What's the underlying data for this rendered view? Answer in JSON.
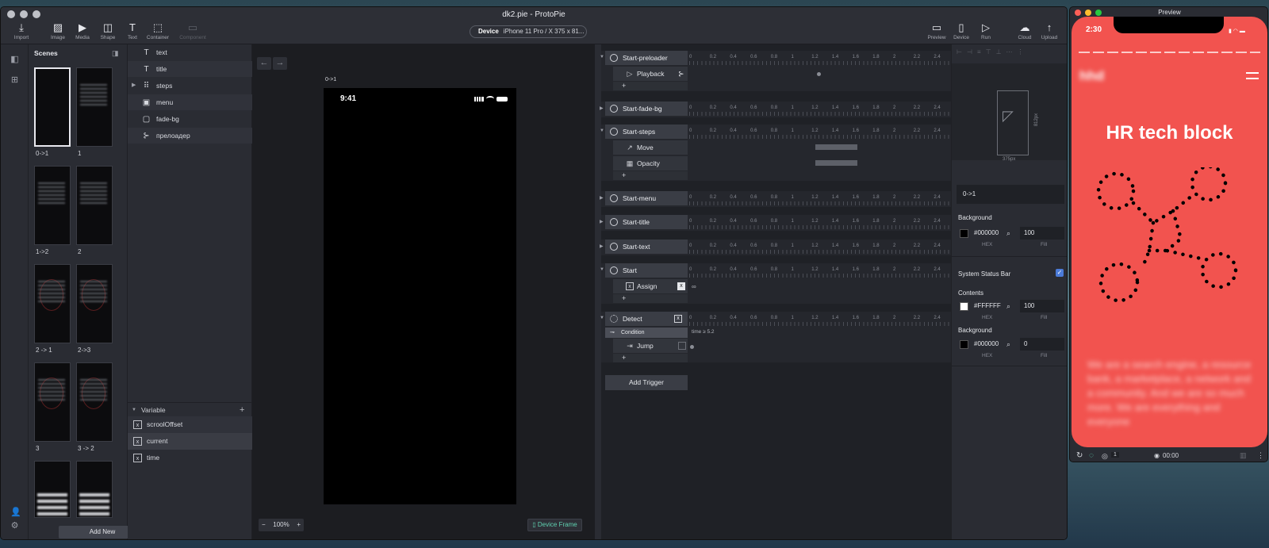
{
  "window": {
    "title": "dk2.pie - ProtoPie"
  },
  "toolbar": {
    "import": "Import",
    "image": "Image",
    "media": "Media",
    "shape": "Shape",
    "text": "Text",
    "container": "Container",
    "component": "Component",
    "device_label": "Device",
    "device_value": "iPhone 11 Pro / X  375 x 81...",
    "preview": "Preview",
    "device": "Device",
    "run": "Run",
    "cloud": "Cloud",
    "upload": "Upload"
  },
  "scenes": {
    "header": "Scenes",
    "items": [
      "0->1",
      "1",
      "1->2",
      "2",
      "2 -> 1",
      "2->3",
      "3",
      "3 -> 2"
    ],
    "add_new": "Add New"
  },
  "layers": [
    {
      "icon": "T",
      "name": "text"
    },
    {
      "icon": "T",
      "name": "title"
    },
    {
      "icon": "⠿",
      "name": "steps"
    },
    {
      "icon": "▣",
      "name": "menu"
    },
    {
      "icon": "▢",
      "name": "fade-bg"
    },
    {
      "icon": "⊱",
      "name": "прелоадер"
    }
  ],
  "variables": {
    "header": "Variable",
    "items": [
      "scroolOffset",
      "current",
      "time"
    ]
  },
  "canvas": {
    "scene_label": "0->1",
    "status_time": "9:41",
    "zoom": "100%",
    "device_frame": "Device Frame"
  },
  "timeline": {
    "ticks": [
      "0",
      "0.2",
      "0.4",
      "0.6",
      "0.8",
      "1",
      "1.2",
      "1.4",
      "1.6",
      "1.8",
      "2",
      "2.2",
      "2.4"
    ],
    "triggers": [
      "Start-preloader",
      "Start-fade-bg",
      "Start-steps",
      "Start-menu",
      "Start-title",
      "Start-text",
      "Start",
      "Detect"
    ],
    "responses": {
      "playback": "Playback",
      "move": "Move",
      "opacity": "Opacity",
      "assign": "Assign",
      "jump": "Jump"
    },
    "condition": "Condition",
    "condition_value": "time ≥ 5.2",
    "plus": "+",
    "add_trigger": "Add Trigger",
    "infinity": "∞"
  },
  "properties": {
    "size_w": "375px",
    "size_h": "812px",
    "scene_name": "0->1",
    "background_label": "Background",
    "bg_hex": "#000000",
    "bg_fill": "100",
    "hex_label": "HEX",
    "fill_label": "Fill",
    "status_bar_label": "System Status Bar",
    "contents_label": "Contents",
    "contents_hex": "#FFFFFF",
    "contents_fill": "100",
    "background2_label": "Background",
    "bg2_hex": "#000000",
    "bg2_fill": "0"
  },
  "preview": {
    "title": "Preview",
    "status_time": "2:30",
    "heading": "HR tech block",
    "logo": "hhd",
    "body": "We are a search engine, a resource bank, a marketplace, a network and a community. And we are so much more. We are everything and everyone",
    "zoom": "1",
    "timer": "00:00"
  }
}
